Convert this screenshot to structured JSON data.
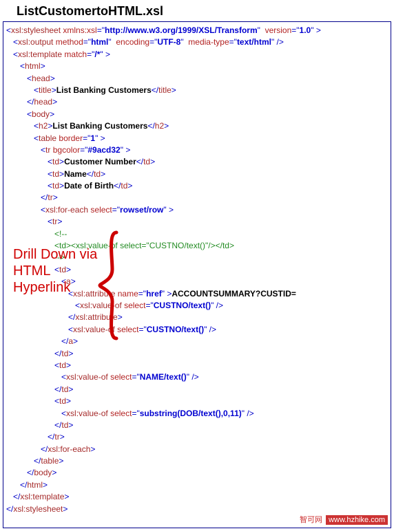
{
  "file_title": "ListCustomertoHTML.xsl",
  "annotation_text": "Drill Down via HTML Hyperlink",
  "watermark": {
    "part1": "智可网",
    "part2": "www.hzhike.com"
  },
  "lines": [
    [
      [
        "p",
        "<"
      ],
      [
        "tag",
        "xsl:stylesheet"
      ],
      [
        "tx",
        " "
      ],
      [
        "an",
        "xmlns:xsl"
      ],
      [
        "p",
        "="
      ],
      [
        "p",
        "\""
      ],
      [
        "av",
        "http://www.w3.org/1999/XSL/Transform"
      ],
      [
        "p",
        "\""
      ],
      [
        "tx",
        "  "
      ],
      [
        "an",
        "version"
      ],
      [
        "p",
        "="
      ],
      [
        "p",
        "\""
      ],
      [
        "av",
        "1.0"
      ],
      [
        "p",
        "\""
      ],
      [
        "p",
        " >"
      ]
    ],
    [
      [
        "tx",
        "   "
      ],
      [
        "p",
        "<"
      ],
      [
        "tag",
        "xsl:output"
      ],
      [
        "tx",
        " "
      ],
      [
        "an",
        "method"
      ],
      [
        "p",
        "="
      ],
      [
        "p",
        "\""
      ],
      [
        "av",
        "html"
      ],
      [
        "p",
        "\""
      ],
      [
        "tx",
        "  "
      ],
      [
        "an",
        "encoding"
      ],
      [
        "p",
        "="
      ],
      [
        "p",
        "\""
      ],
      [
        "av",
        "UTF-8"
      ],
      [
        "p",
        "\""
      ],
      [
        "tx",
        "  "
      ],
      [
        "an",
        "media-type"
      ],
      [
        "p",
        "="
      ],
      [
        "p",
        "\""
      ],
      [
        "av",
        "text/html"
      ],
      [
        "p",
        "\""
      ],
      [
        "p",
        " />"
      ]
    ],
    [
      [
        "tx",
        "   "
      ],
      [
        "p",
        "<"
      ],
      [
        "tag",
        "xsl:template"
      ],
      [
        "tx",
        " "
      ],
      [
        "an",
        "match"
      ],
      [
        "p",
        "="
      ],
      [
        "p",
        "\""
      ],
      [
        "av",
        "/*"
      ],
      [
        "p",
        "\""
      ],
      [
        "p",
        " >"
      ]
    ],
    [
      [
        "tx",
        "      "
      ],
      [
        "p",
        "<"
      ],
      [
        "tag",
        "html"
      ],
      [
        "p",
        ">"
      ]
    ],
    [
      [
        "tx",
        "         "
      ],
      [
        "p",
        "<"
      ],
      [
        "tag",
        "head"
      ],
      [
        "p",
        ">"
      ]
    ],
    [
      [
        "tx",
        "            "
      ],
      [
        "p",
        "<"
      ],
      [
        "tag",
        "title"
      ],
      [
        "p",
        ">"
      ],
      [
        "tx",
        "List Banking Customers"
      ],
      [
        "p",
        "</"
      ],
      [
        "tag",
        "title"
      ],
      [
        "p",
        ">"
      ]
    ],
    [
      [
        "tx",
        "         "
      ],
      [
        "p",
        "</"
      ],
      [
        "tag",
        "head"
      ],
      [
        "p",
        ">"
      ]
    ],
    [
      [
        "tx",
        "         "
      ],
      [
        "p",
        "<"
      ],
      [
        "tag",
        "body"
      ],
      [
        "p",
        ">"
      ]
    ],
    [
      [
        "tx",
        "            "
      ],
      [
        "p",
        "<"
      ],
      [
        "tag",
        "h2"
      ],
      [
        "p",
        ">"
      ],
      [
        "tx",
        "List Banking Customers"
      ],
      [
        "p",
        "</"
      ],
      [
        "tag",
        "h2"
      ],
      [
        "p",
        ">"
      ]
    ],
    [
      [
        "tx",
        "            "
      ],
      [
        "p",
        "<"
      ],
      [
        "tag",
        "table"
      ],
      [
        "tx",
        " "
      ],
      [
        "an",
        "border"
      ],
      [
        "p",
        "="
      ],
      [
        "p",
        "\""
      ],
      [
        "av",
        "1"
      ],
      [
        "p",
        "\""
      ],
      [
        "p",
        " >"
      ]
    ],
    [
      [
        "tx",
        "               "
      ],
      [
        "p",
        "<"
      ],
      [
        "tag",
        "tr"
      ],
      [
        "tx",
        " "
      ],
      [
        "an",
        "bgcolor"
      ],
      [
        "p",
        "="
      ],
      [
        "p",
        "\""
      ],
      [
        "av",
        "#9acd32"
      ],
      [
        "p",
        "\""
      ],
      [
        "p",
        " >"
      ]
    ],
    [
      [
        "tx",
        "                  "
      ],
      [
        "p",
        "<"
      ],
      [
        "tag",
        "td"
      ],
      [
        "p",
        ">"
      ],
      [
        "tx",
        "Customer Number"
      ],
      [
        "p",
        "</"
      ],
      [
        "tag",
        "td"
      ],
      [
        "p",
        ">"
      ]
    ],
    [
      [
        "tx",
        "                  "
      ],
      [
        "p",
        "<"
      ],
      [
        "tag",
        "td"
      ],
      [
        "p",
        ">"
      ],
      [
        "tx",
        "Name"
      ],
      [
        "p",
        "</"
      ],
      [
        "tag",
        "td"
      ],
      [
        "p",
        ">"
      ]
    ],
    [
      [
        "tx",
        "                  "
      ],
      [
        "p",
        "<"
      ],
      [
        "tag",
        "td"
      ],
      [
        "p",
        ">"
      ],
      [
        "tx",
        "Date of Birth"
      ],
      [
        "p",
        "</"
      ],
      [
        "tag",
        "td"
      ],
      [
        "p",
        ">"
      ]
    ],
    [
      [
        "tx",
        "               "
      ],
      [
        "p",
        "</"
      ],
      [
        "tag",
        "tr"
      ],
      [
        "p",
        ">"
      ]
    ],
    [
      [
        "tx",
        "               "
      ],
      [
        "p",
        "<"
      ],
      [
        "tag",
        "xsl:for-each"
      ],
      [
        "tx",
        " "
      ],
      [
        "an",
        "select"
      ],
      [
        "p",
        "="
      ],
      [
        "p",
        "\""
      ],
      [
        "av",
        "rowset/row"
      ],
      [
        "p",
        "\""
      ],
      [
        "p",
        " >"
      ]
    ],
    [
      [
        "tx",
        "                  "
      ],
      [
        "p",
        "<"
      ],
      [
        "tag",
        "tr"
      ],
      [
        "p",
        ">"
      ]
    ],
    [
      [
        "tx",
        "                     "
      ],
      [
        "cm",
        "<!--"
      ]
    ],
    [
      [
        "tx",
        "                     "
      ],
      [
        "cm",
        "<td><xsl:value-of select=\"CUSTNO/text()\"/></td>"
      ]
    ],
    [
      [
        "tx",
        "                     "
      ],
      [
        "cm",
        "-->"
      ]
    ],
    [
      [
        "tx",
        "                     "
      ],
      [
        "p",
        "<"
      ],
      [
        "tag",
        "td"
      ],
      [
        "p",
        ">"
      ]
    ],
    [
      [
        "tx",
        "                        "
      ],
      [
        "p",
        "<"
      ],
      [
        "tag",
        "a"
      ],
      [
        "p",
        ">"
      ]
    ],
    [
      [
        "tx",
        "                           "
      ],
      [
        "p",
        "<"
      ],
      [
        "tag",
        "xsl:attribute"
      ],
      [
        "tx",
        " "
      ],
      [
        "an",
        "name"
      ],
      [
        "p",
        "="
      ],
      [
        "p",
        "\""
      ],
      [
        "av",
        "href"
      ],
      [
        "p",
        "\""
      ],
      [
        "p",
        " >"
      ],
      [
        "tx",
        "ACCOUNTSUMMARY?CUSTID="
      ]
    ],
    [
      [
        "tx",
        "                              "
      ],
      [
        "p",
        "<"
      ],
      [
        "tag",
        "xsl:value-of"
      ],
      [
        "tx",
        " "
      ],
      [
        "an",
        "select"
      ],
      [
        "p",
        "="
      ],
      [
        "p",
        "\""
      ],
      [
        "av",
        "CUSTNO/text()"
      ],
      [
        "p",
        "\""
      ],
      [
        "p",
        " />"
      ]
    ],
    [
      [
        "tx",
        "                           "
      ],
      [
        "p",
        "</"
      ],
      [
        "tag",
        "xsl:attribute"
      ],
      [
        "p",
        ">"
      ]
    ],
    [
      [
        "tx",
        "                           "
      ],
      [
        "p",
        "<"
      ],
      [
        "tag",
        "xsl:value-of"
      ],
      [
        "tx",
        " "
      ],
      [
        "an",
        "select"
      ],
      [
        "p",
        "="
      ],
      [
        "p",
        "\""
      ],
      [
        "av",
        "CUSTNO/text()"
      ],
      [
        "p",
        "\""
      ],
      [
        "p",
        " />"
      ]
    ],
    [
      [
        "tx",
        "                        "
      ],
      [
        "p",
        "</"
      ],
      [
        "tag",
        "a"
      ],
      [
        "p",
        ">"
      ]
    ],
    [
      [
        "tx",
        "                     "
      ],
      [
        "p",
        "</"
      ],
      [
        "tag",
        "td"
      ],
      [
        "p",
        ">"
      ]
    ],
    [
      [
        "tx",
        "                     "
      ],
      [
        "p",
        "<"
      ],
      [
        "tag",
        "td"
      ],
      [
        "p",
        ">"
      ]
    ],
    [
      [
        "tx",
        "                        "
      ],
      [
        "p",
        "<"
      ],
      [
        "tag",
        "xsl:value-of"
      ],
      [
        "tx",
        " "
      ],
      [
        "an",
        "select"
      ],
      [
        "p",
        "="
      ],
      [
        "p",
        "\""
      ],
      [
        "av",
        "NAME/text()"
      ],
      [
        "p",
        "\""
      ],
      [
        "p",
        " />"
      ]
    ],
    [
      [
        "tx",
        "                     "
      ],
      [
        "p",
        "</"
      ],
      [
        "tag",
        "td"
      ],
      [
        "p",
        ">"
      ]
    ],
    [
      [
        "tx",
        "                     "
      ],
      [
        "p",
        "<"
      ],
      [
        "tag",
        "td"
      ],
      [
        "p",
        ">"
      ]
    ],
    [
      [
        "tx",
        "                        "
      ],
      [
        "p",
        "<"
      ],
      [
        "tag",
        "xsl:value-of"
      ],
      [
        "tx",
        " "
      ],
      [
        "an",
        "select"
      ],
      [
        "p",
        "="
      ],
      [
        "p",
        "\""
      ],
      [
        "av",
        "substring(DOB/text(),0,11)"
      ],
      [
        "p",
        "\""
      ],
      [
        "p",
        " />"
      ]
    ],
    [
      [
        "tx",
        "                     "
      ],
      [
        "p",
        "</"
      ],
      [
        "tag",
        "td"
      ],
      [
        "p",
        ">"
      ]
    ],
    [
      [
        "tx",
        "                  "
      ],
      [
        "p",
        "</"
      ],
      [
        "tag",
        "tr"
      ],
      [
        "p",
        ">"
      ]
    ],
    [
      [
        "tx",
        "               "
      ],
      [
        "p",
        "</"
      ],
      [
        "tag",
        "xsl:for-each"
      ],
      [
        "p",
        ">"
      ]
    ],
    [
      [
        "tx",
        "            "
      ],
      [
        "p",
        "</"
      ],
      [
        "tag",
        "table"
      ],
      [
        "p",
        ">"
      ]
    ],
    [
      [
        "tx",
        "         "
      ],
      [
        "p",
        "</"
      ],
      [
        "tag",
        "body"
      ],
      [
        "p",
        ">"
      ]
    ],
    [
      [
        "tx",
        "      "
      ],
      [
        "p",
        "</"
      ],
      [
        "tag",
        "html"
      ],
      [
        "p",
        ">"
      ]
    ],
    [
      [
        "tx",
        "   "
      ],
      [
        "p",
        "</"
      ],
      [
        "tag",
        "xsl:template"
      ],
      [
        "p",
        ">"
      ]
    ],
    [
      [
        "p",
        "</"
      ],
      [
        "tag",
        "xsl:stylesheet"
      ],
      [
        "p",
        ">"
      ]
    ]
  ]
}
